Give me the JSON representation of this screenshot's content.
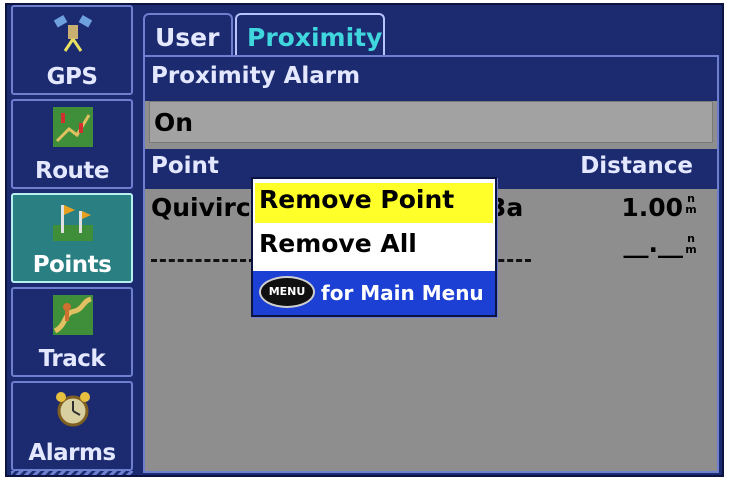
{
  "sidebar": {
    "items": [
      {
        "label": "GPS",
        "icon": "satellite-icon"
      },
      {
        "label": "Route",
        "icon": "route-icon"
      },
      {
        "label": "Points",
        "icon": "flags-icon"
      },
      {
        "label": "Track",
        "icon": "track-icon"
      },
      {
        "label": "Alarms",
        "icon": "alarm-clock-icon"
      }
    ],
    "active": "Points"
  },
  "tabs": [
    {
      "label": "User"
    },
    {
      "label": "Proximity"
    }
  ],
  "active_tab": "Proximity",
  "proximity": {
    "alarm_label": "Proximity Alarm",
    "alarm_value": "On",
    "columns": {
      "point": "Point",
      "distance": "Distance"
    },
    "rows": [
      {
        "name_left": "Quivirc",
        "name_right": "3a",
        "distance": "1.00",
        "unit_top": "n",
        "unit_bottom": "m"
      },
      {
        "name_left": "",
        "name_right": "",
        "distance": "__.__",
        "unit_top": "n",
        "unit_bottom": "m"
      }
    ]
  },
  "popup": {
    "items": [
      "Remove Point",
      "Remove All"
    ],
    "selected": "Remove Point",
    "menu_key": "MENU",
    "footer": "for Main Menu"
  },
  "colors": {
    "background": "#1c2b70",
    "active_tab": "#3fd6de",
    "highlight": "#ffff2a",
    "footer": "#1c3fd4"
  }
}
